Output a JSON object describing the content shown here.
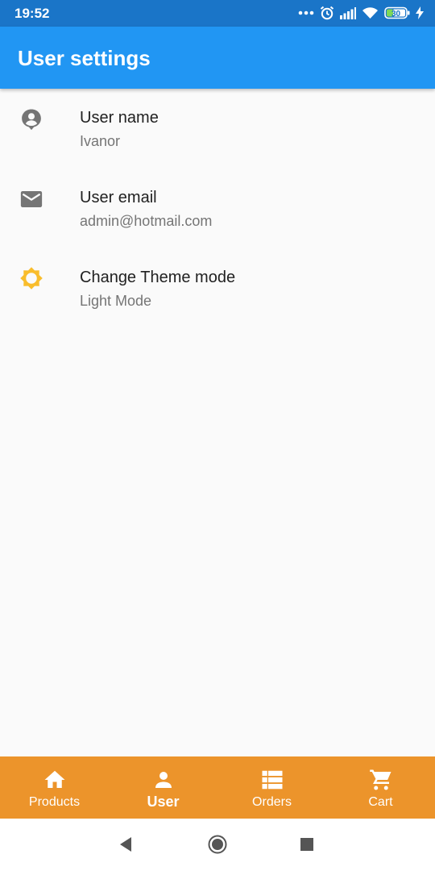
{
  "status_bar": {
    "time": "19:52",
    "battery_level": "30",
    "icons": [
      "more-dots-icon",
      "alarm-icon",
      "signal-icon",
      "wifi-icon",
      "battery-icon",
      "charging-icon"
    ]
  },
  "app_bar": {
    "title": "User settings"
  },
  "settings": [
    {
      "title": "User name",
      "subtitle": "Ivanor",
      "icon": "account-pin-icon"
    },
    {
      "title": "User email",
      "subtitle": "admin@hotmail.com",
      "icon": "email-icon"
    },
    {
      "title": "Change Theme mode",
      "subtitle": "Light Mode",
      "icon": "sun-icon"
    }
  ],
  "bottom_nav": {
    "items": [
      {
        "label": "Products",
        "icon": "home-icon",
        "active": false
      },
      {
        "label": "User",
        "icon": "person-icon",
        "active": true
      },
      {
        "label": "Orders",
        "icon": "list-icon",
        "active": false
      },
      {
        "label": "Cart",
        "icon": "cart-icon",
        "active": false
      }
    ]
  },
  "system_nav": {
    "icons": [
      "back-icon",
      "home-circle-icon",
      "recents-icon"
    ]
  },
  "colors": {
    "status_bar": "#1a75c8",
    "app_bar": "#2196f3",
    "bottom_nav": "#ec942b",
    "sun_icon": "#f9bd2c",
    "list_icon": "#757575",
    "background": "#fafafa"
  }
}
